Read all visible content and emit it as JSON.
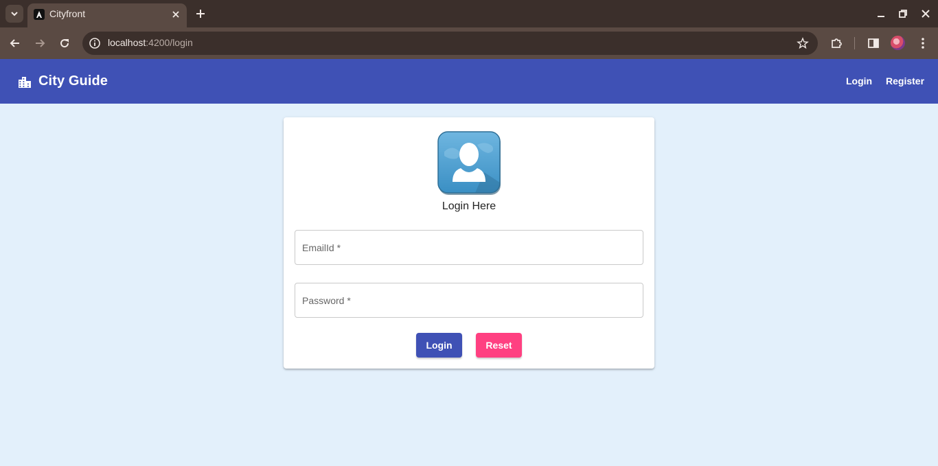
{
  "browser": {
    "tab_title": "Cityfront",
    "url_host": "localhost",
    "url_path": ":4200/login"
  },
  "app": {
    "brand_title": "City Guide",
    "nav": {
      "login_label": "Login",
      "register_label": "Register"
    }
  },
  "login_form": {
    "heading": "Login Here",
    "email_placeholder": "EmailId *",
    "password_placeholder": "Password *",
    "login_button": "Login",
    "reset_button": "Reset"
  },
  "colors": {
    "primary": "#3f51b5",
    "accent": "#ff4081",
    "page_background": "#e3f0fb"
  },
  "icons": {
    "brand": "location-city-icon",
    "login": "user-avatar-icon"
  }
}
